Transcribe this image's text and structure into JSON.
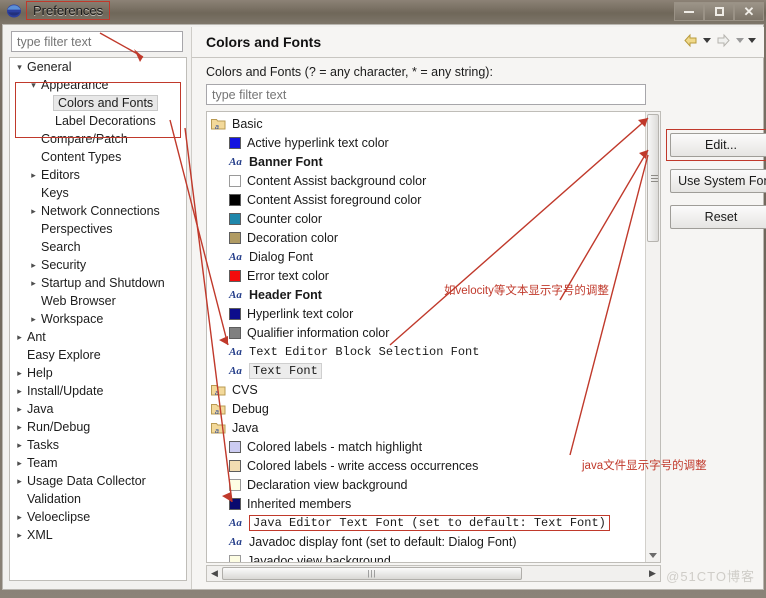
{
  "window": {
    "title": "Preferences",
    "icon": "eclipse-icon",
    "buttons": {
      "minimize": "minimize-button",
      "maximize": "maximize-button",
      "close": "close-button"
    }
  },
  "left_panel": {
    "filter_placeholder": "type filter text",
    "filter_value": "",
    "tree": [
      {
        "label": "General",
        "indent": 0,
        "twisty": "expanded",
        "selected": false
      },
      {
        "label": "Appearance",
        "indent": 1,
        "twisty": "expanded",
        "selected": false
      },
      {
        "label": "Colors and Fonts",
        "indent": 2,
        "twisty": "none",
        "selected": true
      },
      {
        "label": "Label Decorations",
        "indent": 2,
        "twisty": "none",
        "selected": false
      },
      {
        "label": "Compare/Patch",
        "indent": 1,
        "twisty": "none",
        "selected": false
      },
      {
        "label": "Content Types",
        "indent": 1,
        "twisty": "none",
        "selected": false
      },
      {
        "label": "Editors",
        "indent": 1,
        "twisty": "collapsed",
        "selected": false
      },
      {
        "label": "Keys",
        "indent": 1,
        "twisty": "none",
        "selected": false
      },
      {
        "label": "Network Connections",
        "indent": 1,
        "twisty": "collapsed",
        "selected": false
      },
      {
        "label": "Perspectives",
        "indent": 1,
        "twisty": "none",
        "selected": false
      },
      {
        "label": "Search",
        "indent": 1,
        "twisty": "none",
        "selected": false
      },
      {
        "label": "Security",
        "indent": 1,
        "twisty": "collapsed",
        "selected": false
      },
      {
        "label": "Startup and Shutdown",
        "indent": 1,
        "twisty": "collapsed",
        "selected": false
      },
      {
        "label": "Web Browser",
        "indent": 1,
        "twisty": "none",
        "selected": false
      },
      {
        "label": "Workspace",
        "indent": 1,
        "twisty": "collapsed",
        "selected": false
      },
      {
        "label": "Ant",
        "indent": 0,
        "twisty": "collapsed",
        "selected": false
      },
      {
        "label": "Easy Explore",
        "indent": 0,
        "twisty": "none",
        "selected": false
      },
      {
        "label": "Help",
        "indent": 0,
        "twisty": "collapsed",
        "selected": false
      },
      {
        "label": "Install/Update",
        "indent": 0,
        "twisty": "collapsed",
        "selected": false
      },
      {
        "label": "Java",
        "indent": 0,
        "twisty": "collapsed",
        "selected": false
      },
      {
        "label": "Run/Debug",
        "indent": 0,
        "twisty": "collapsed",
        "selected": false
      },
      {
        "label": "Tasks",
        "indent": 0,
        "twisty": "collapsed",
        "selected": false
      },
      {
        "label": "Team",
        "indent": 0,
        "twisty": "collapsed",
        "selected": false
      },
      {
        "label": "Usage Data Collector",
        "indent": 0,
        "twisty": "collapsed",
        "selected": false
      },
      {
        "label": "Validation",
        "indent": 0,
        "twisty": "none",
        "selected": false
      },
      {
        "label": "Veloeclipse",
        "indent": 0,
        "twisty": "collapsed",
        "selected": false
      },
      {
        "label": "XML",
        "indent": 0,
        "twisty": "collapsed",
        "selected": false
      }
    ]
  },
  "right_panel": {
    "title": "Colors and Fonts",
    "subtitle": "Colors and Fonts (? = any character, * = any string):",
    "filter_placeholder": "type filter text",
    "filter_value": "",
    "nav": {
      "back": "back-arrow-icon",
      "back_menu": "back-dropdown-icon",
      "forward": "forward-arrow-icon",
      "forward_menu": "forward-dropdown-icon",
      "view_menu": "view-menu-icon"
    },
    "buttons": {
      "edit": "Edit...",
      "use_system_font": "Use System Font",
      "reset": "Reset"
    },
    "tree": [
      {
        "label": "Basic",
        "kind": "folder",
        "indent": 0,
        "style": "normal",
        "boxed": false,
        "highlighted": false
      },
      {
        "label": "Active hyperlink text color",
        "kind": "color",
        "color": "#1414e0",
        "indent": 1,
        "style": "normal",
        "boxed": false,
        "highlighted": false
      },
      {
        "label": "Banner Font",
        "kind": "font",
        "indent": 1,
        "style": "bold",
        "boxed": false,
        "highlighted": false
      },
      {
        "label": "Content Assist background color",
        "kind": "color",
        "color": "#ffffff",
        "indent": 1,
        "style": "normal",
        "boxed": false,
        "highlighted": false
      },
      {
        "label": "Content Assist foreground color",
        "kind": "color",
        "color": "#000000",
        "indent": 1,
        "style": "normal",
        "boxed": false,
        "highlighted": false
      },
      {
        "label": "Counter color",
        "kind": "color",
        "color": "#1f87ab",
        "indent": 1,
        "style": "normal",
        "boxed": false,
        "highlighted": false
      },
      {
        "label": "Decoration color",
        "kind": "color",
        "color": "#b09b63",
        "indent": 1,
        "style": "normal",
        "boxed": false,
        "highlighted": false
      },
      {
        "label": "Dialog Font",
        "kind": "font",
        "indent": 1,
        "style": "normal",
        "boxed": false,
        "highlighted": false
      },
      {
        "label": "Error text color",
        "kind": "color",
        "color": "#f40b0b",
        "indent": 1,
        "style": "normal",
        "boxed": false,
        "highlighted": false
      },
      {
        "label": "Header Font",
        "kind": "font",
        "indent": 1,
        "style": "bold",
        "boxed": false,
        "highlighted": false
      },
      {
        "label": "Hyperlink text color",
        "kind": "color",
        "color": "#0d0d8c",
        "indent": 1,
        "style": "normal",
        "boxed": false,
        "highlighted": false
      },
      {
        "label": "Qualifier information color",
        "kind": "color",
        "color": "#808080",
        "indent": 1,
        "style": "normal",
        "boxed": false,
        "highlighted": false
      },
      {
        "label": "Text Editor Block Selection Font",
        "kind": "font",
        "indent": 1,
        "style": "mono",
        "boxed": false,
        "highlighted": false
      },
      {
        "label": "Text Font",
        "kind": "font",
        "indent": 1,
        "style": "mono",
        "boxed": true,
        "highlighted": true
      },
      {
        "label": "CVS",
        "kind": "folder",
        "indent": 0,
        "style": "normal",
        "boxed": false,
        "highlighted": false
      },
      {
        "label": "Debug",
        "kind": "folder",
        "indent": 0,
        "style": "normal",
        "boxed": false,
        "highlighted": false
      },
      {
        "label": "Java",
        "kind": "folder",
        "indent": 0,
        "style": "normal",
        "boxed": false,
        "highlighted": false
      },
      {
        "label": "Colored labels - match highlight",
        "kind": "color",
        "color": "#ccccf2",
        "indent": 1,
        "style": "normal",
        "boxed": false,
        "highlighted": false
      },
      {
        "label": "Colored labels - write access occurrences",
        "kind": "color",
        "color": "#f2ddb2",
        "indent": 1,
        "style": "normal",
        "boxed": false,
        "highlighted": false
      },
      {
        "label": "Declaration view background",
        "kind": "color",
        "color": "#fdfde3",
        "indent": 1,
        "style": "normal",
        "boxed": false,
        "highlighted": false
      },
      {
        "label": "Inherited members",
        "kind": "color",
        "color": "#0a0a6e",
        "indent": 1,
        "style": "normal",
        "boxed": false,
        "highlighted": false
      },
      {
        "label": "Java Editor Text Font (set to default: Text Font)",
        "kind": "font",
        "indent": 1,
        "style": "mono",
        "boxed": true,
        "highlighted": false
      },
      {
        "label": "Javadoc display font (set to default: Dialog Font)",
        "kind": "font",
        "indent": 1,
        "style": "normal",
        "boxed": false,
        "highlighted": false
      },
      {
        "label": "Javadoc view background",
        "kind": "color",
        "color": "#fdfde3",
        "indent": 1,
        "style": "normal",
        "boxed": false,
        "highlighted": false
      }
    ],
    "scrollbars": {
      "vertical": "vertical-scrollbar",
      "horizontal": "horizontal-scrollbar"
    }
  },
  "annotations": {
    "velocity_note": "如velocity等文本显示字号的调整",
    "java_note": "java文件显示字号的调整",
    "accent_color": "#c0392b"
  },
  "watermark": "@51CTO博客"
}
